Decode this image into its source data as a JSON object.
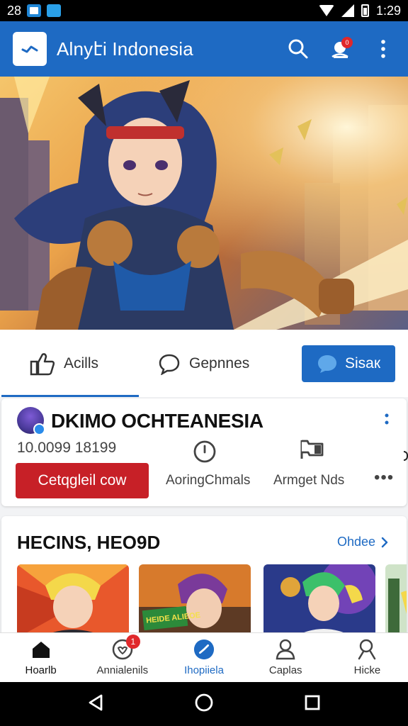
{
  "status_bar": {
    "time_left": "28",
    "clock": "1:29"
  },
  "app_bar": {
    "title": "Alnyէi Indonesia",
    "notification_count": "0",
    "icons": [
      "search-icon",
      "notification-bell-icon",
      "more-vertical-icon"
    ]
  },
  "hero": {
    "image_name": "anime-warrior-banner"
  },
  "reactions": {
    "like_label": "Acills",
    "comment_label": "Gepnnes",
    "share_label": "Sisaк"
  },
  "channel": {
    "name": "DKIMO OCHTEANESIA",
    "stats": "10.0099 18199",
    "subscribe_label": "Cetqgleil cow",
    "tab_1": "AoringChmals",
    "tab_2": "Armget Nds",
    "more": "•••"
  },
  "heroes_section": {
    "title": "HECINS, HEO9D",
    "see_more": "Ohdee",
    "thumb_text": "HEIDE\nALIEOE"
  },
  "bottom_nav": {
    "items": [
      {
        "label": "Hoarlb",
        "icon": "home-icon"
      },
      {
        "label": "Annialenils",
        "icon": "heart-badge-icon",
        "badge": "1"
      },
      {
        "label": "Ihopiiela",
        "icon": "check-circle-icon"
      },
      {
        "label": "Caplas",
        "icon": "person-icon"
      },
      {
        "label": "Hicke",
        "icon": "search-person-icon"
      }
    ]
  },
  "colors": {
    "primary": "#1e6ac3",
    "subscribe": "#c72027",
    "badge": "#e0282b"
  }
}
